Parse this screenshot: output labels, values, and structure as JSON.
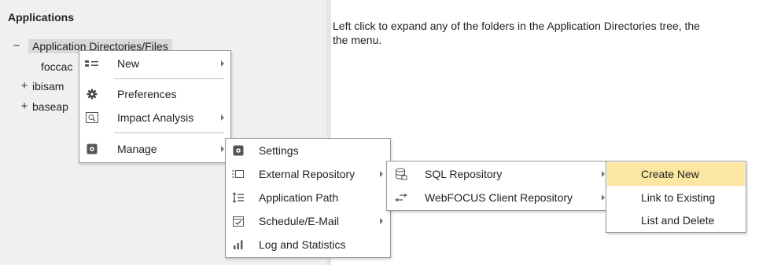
{
  "left_panel": {
    "title": "Applications",
    "tree": [
      {
        "toggle": "−",
        "label": "Application Directories/Files"
      },
      {
        "toggle": "",
        "label": "foccac"
      },
      {
        "toggle": "+",
        "label": "ibisam"
      },
      {
        "toggle": "+",
        "label": "baseap"
      }
    ]
  },
  "right_panel": {
    "help_text_line1": "Left click to expand any of the folders in the Application Directories tree, the",
    "help_text_line2": "the menu."
  },
  "context_menu": {
    "items": [
      {
        "label": "New",
        "icon": "new-icon",
        "has_submenu": true
      },
      {
        "label": "Preferences",
        "icon": "gear-icon",
        "has_submenu": false
      },
      {
        "label": "Impact Analysis",
        "icon": "impact-analysis-icon",
        "has_submenu": true
      },
      {
        "label": "Manage",
        "icon": "manage-icon",
        "has_submenu": true
      }
    ]
  },
  "manage_submenu": {
    "items": [
      {
        "label": "Settings",
        "icon": "settings-icon",
        "has_submenu": false
      },
      {
        "label": "External Repository",
        "icon": "external-repository-icon",
        "has_submenu": true
      },
      {
        "label": "Application Path",
        "icon": "application-path-icon",
        "has_submenu": false
      },
      {
        "label": "Schedule/E-Mail",
        "icon": "calendar-icon",
        "has_submenu": true
      },
      {
        "label": "Log and Statistics",
        "icon": "bar-chart-icon",
        "has_submenu": false
      }
    ]
  },
  "external_repository_submenu": {
    "items": [
      {
        "label": "SQL Repository",
        "icon": "database-icon",
        "has_submenu": true
      },
      {
        "label": "WebFOCUS Client Repository",
        "icon": "transfer-icon",
        "has_submenu": true
      }
    ]
  },
  "sql_repository_submenu": {
    "items": [
      {
        "label": "Create New",
        "highlighted": true
      },
      {
        "label": "Link to Existing",
        "highlighted": false
      },
      {
        "label": "List and Delete",
        "highlighted": false
      }
    ]
  },
  "colors": {
    "highlight": "#fbe7a1",
    "pane_background": "#f0f0f0",
    "menu_border": "#9a9a9a"
  }
}
